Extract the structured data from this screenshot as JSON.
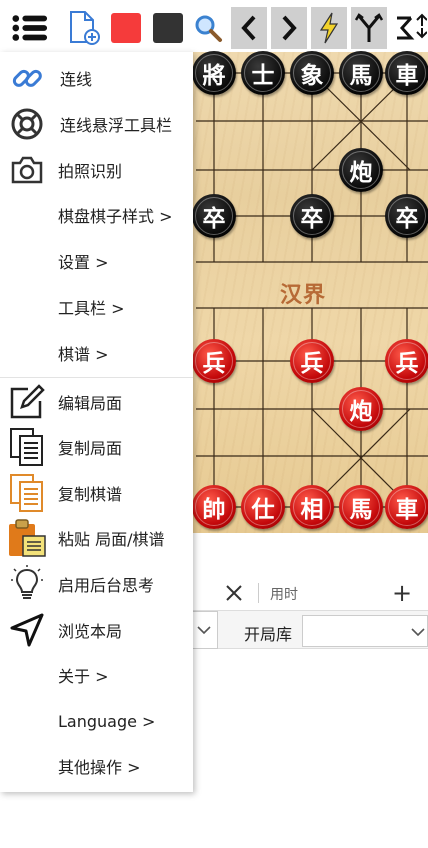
{
  "toolbar": {
    "buttons": [
      {
        "icon": "hamburger-menu-icon"
      },
      {
        "icon": "new-document-icon"
      },
      {
        "icon": "red-square-icon",
        "color": "#f53b3b"
      },
      {
        "icon": "black-square-icon",
        "color": "#333333"
      },
      {
        "icon": "search-icon"
      },
      {
        "icon": "chevron-left-icon"
      },
      {
        "icon": "chevron-right-icon"
      },
      {
        "icon": "lightning-icon"
      },
      {
        "icon": "branch-icon"
      },
      {
        "icon": "sort-icon"
      }
    ]
  },
  "board": {
    "river_text": "汉界",
    "pieces": [
      {
        "char": "將",
        "side": "black"
      },
      {
        "char": "士",
        "side": "black"
      },
      {
        "char": "象",
        "side": "black"
      },
      {
        "char": "馬",
        "side": "black"
      },
      {
        "char": "車",
        "side": "black"
      },
      {
        "char": "炮",
        "side": "black"
      },
      {
        "char": "卒",
        "side": "black"
      },
      {
        "char": "卒",
        "side": "black"
      },
      {
        "char": "卒",
        "side": "black"
      },
      {
        "char": "兵",
        "side": "red"
      },
      {
        "char": "兵",
        "side": "red"
      },
      {
        "char": "兵",
        "side": "red"
      },
      {
        "char": "炮",
        "side": "red"
      },
      {
        "char": "帥",
        "side": "red"
      },
      {
        "char": "仕",
        "side": "red"
      },
      {
        "char": "相",
        "side": "red"
      },
      {
        "char": "馬",
        "side": "red"
      },
      {
        "char": "車",
        "side": "red"
      }
    ]
  },
  "panel": {
    "timer_label": "用时",
    "plus": "+",
    "close": "×",
    "opening_label": "开局库"
  },
  "menu": {
    "items": [
      {
        "label": "连线",
        "icon": "link-icon"
      },
      {
        "label": "连线悬浮工具栏",
        "icon": "lifebuoy-icon"
      },
      {
        "label": "拍照识别",
        "icon": "camera-icon"
      },
      {
        "label": "棋盘棋子样式 >",
        "icon": ""
      },
      {
        "label": "设置 >",
        "icon": ""
      },
      {
        "label": "工具栏 >",
        "icon": ""
      },
      {
        "label": "棋谱 >",
        "icon": ""
      },
      {
        "label": "编辑局面",
        "icon": "edit-icon"
      },
      {
        "label": "复制局面",
        "icon": "copy-document-icon"
      },
      {
        "label": "复制棋谱",
        "icon": "copy-record-icon"
      },
      {
        "label": "粘贴 局面/棋谱",
        "icon": "paste-clipboard-icon"
      },
      {
        "label": "启用后台思考",
        "icon": "lightbulb-icon"
      },
      {
        "label": "浏览本局",
        "icon": "navigate-arrow-icon"
      },
      {
        "label": "关于 >",
        "icon": ""
      },
      {
        "label": "Language >",
        "icon": ""
      },
      {
        "label": "其他操作 >",
        "icon": ""
      }
    ]
  }
}
